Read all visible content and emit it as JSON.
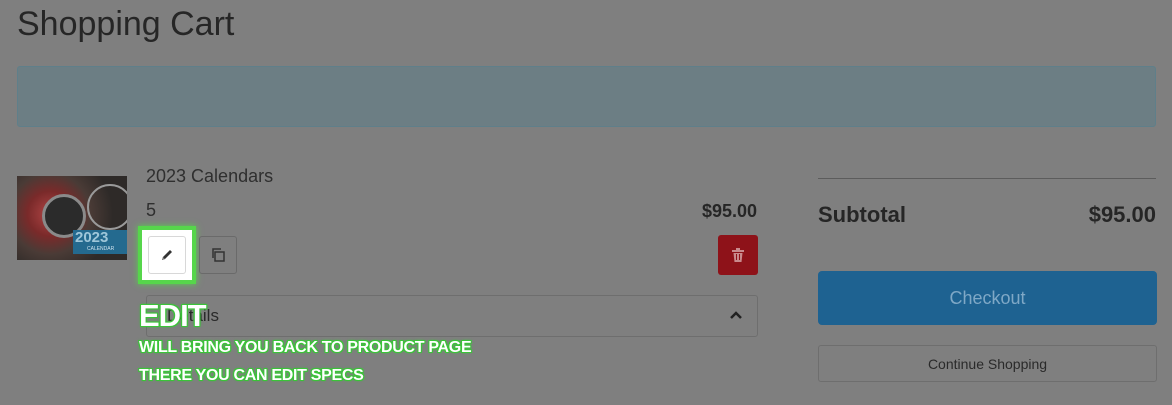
{
  "page": {
    "title": "Shopping Cart"
  },
  "cart": {
    "item": {
      "name": "2023 Calendars",
      "quantity": "5",
      "price": "$95.00",
      "thumbnail": {
        "year_text": "2023",
        "caption": "CALENDAR"
      },
      "actions": {
        "edit_icon": "pencil-icon",
        "copy_icon": "copy-icon",
        "delete_icon": "trash-icon"
      },
      "details_label": "Details"
    }
  },
  "summary": {
    "subtotal_label": "Subtotal",
    "subtotal_value": "$95.00",
    "checkout_label": "Checkout",
    "continue_label": "Continue Shopping"
  },
  "annotation": {
    "title": "EDIT",
    "line1": "WILL BRING YOU BACK TO PRODUCT PAGE",
    "line2": "THERE YOU CAN EDIT SPECS"
  },
  "colors": {
    "overlay": "#7f7f7f",
    "checkout": "#1e6291",
    "delete": "#8e1219",
    "annotation_green": "#56d64b"
  }
}
